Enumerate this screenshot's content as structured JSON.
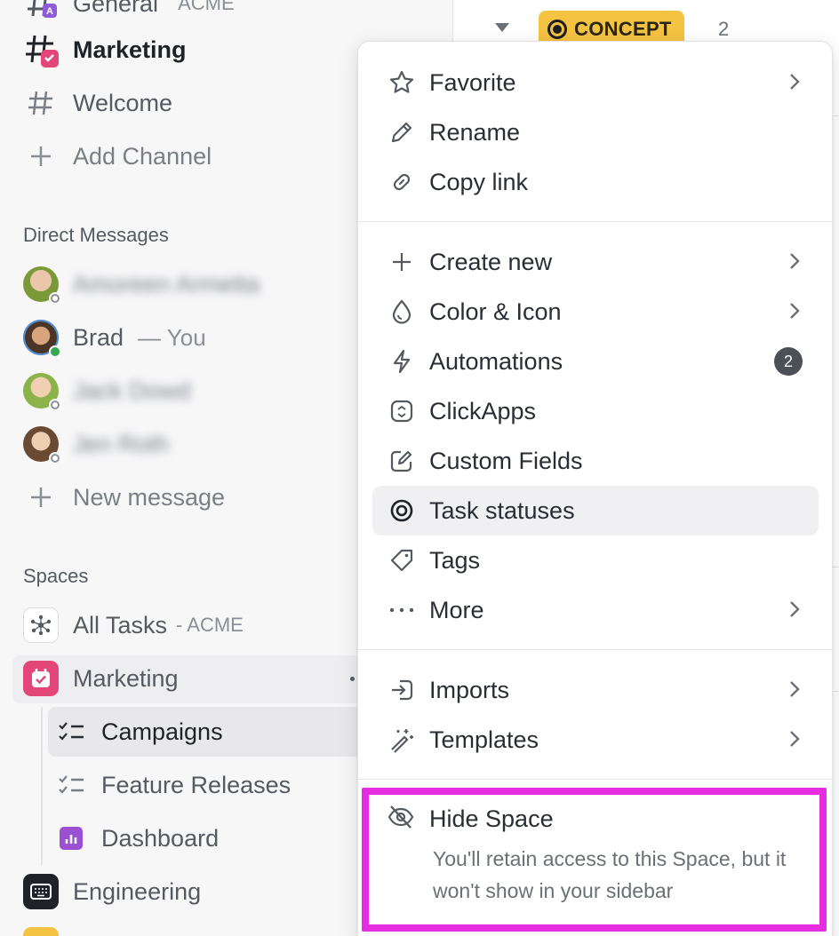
{
  "sidebar": {
    "channels": {
      "top_label": "General",
      "top_sub": "ACME",
      "items": [
        {
          "label": "Marketing",
          "icon": "hash-marketing-icon"
        },
        {
          "label": "Welcome",
          "icon": "hash-icon"
        },
        {
          "label": "Add Channel",
          "icon": "plus-icon"
        }
      ]
    },
    "direct_messages": {
      "heading": "Direct Messages",
      "people": [
        {
          "name": "Amoreen Armetta",
          "status": "offline"
        },
        {
          "name": "Brad",
          "suffix": "— You",
          "status": "online"
        },
        {
          "name": "Jack Dowd",
          "status": "offline"
        },
        {
          "name": "Jen Roth",
          "status": "offline"
        }
      ],
      "new_message": "New message"
    },
    "spaces": {
      "heading": "Spaces",
      "all_tasks": "All Tasks",
      "all_tasks_sub": "- ACME",
      "marketing": "Marketing",
      "children": [
        {
          "label": "Campaigns",
          "icon": "checklist-icon"
        },
        {
          "label": "Feature Releases",
          "icon": "checklist-icon"
        },
        {
          "label": "Dashboard",
          "icon": "dashboard-icon"
        }
      ],
      "engineering": "Engineering"
    }
  },
  "content": {
    "status_label": "CONCEPT",
    "status_count": "2",
    "status_color": "#f5c342"
  },
  "menu": {
    "group1": [
      {
        "label": "Favorite",
        "icon": "star-icon",
        "chevron": true
      },
      {
        "label": "Rename",
        "icon": "pencil-icon"
      },
      {
        "label": "Copy link",
        "icon": "link-icon"
      }
    ],
    "group2": [
      {
        "label": "Create new",
        "icon": "plus-icon",
        "chevron": true
      },
      {
        "label": "Color & Icon",
        "icon": "droplet-icon",
        "chevron": true
      },
      {
        "label": "Automations",
        "icon": "bolt-icon",
        "badge": "2"
      },
      {
        "label": "ClickApps",
        "icon": "clickapps-icon"
      },
      {
        "label": "Custom Fields",
        "icon": "edit-square-icon"
      },
      {
        "label": "Task statuses",
        "icon": "target-icon",
        "active": true
      },
      {
        "label": "Tags",
        "icon": "tag-icon"
      },
      {
        "label": "More",
        "icon": "more-dots-icon",
        "chevron": true
      }
    ],
    "group3": [
      {
        "label": "Imports",
        "icon": "import-icon",
        "chevron": true
      },
      {
        "label": "Templates",
        "icon": "magic-wand-icon",
        "chevron": true
      }
    ],
    "hide_space": {
      "title": "Hide Space",
      "description": "You'll retain access to this Space, but it won't show in your sidebar",
      "icon": "eye-off-icon",
      "highlight_color": "#e62ee0"
    }
  }
}
